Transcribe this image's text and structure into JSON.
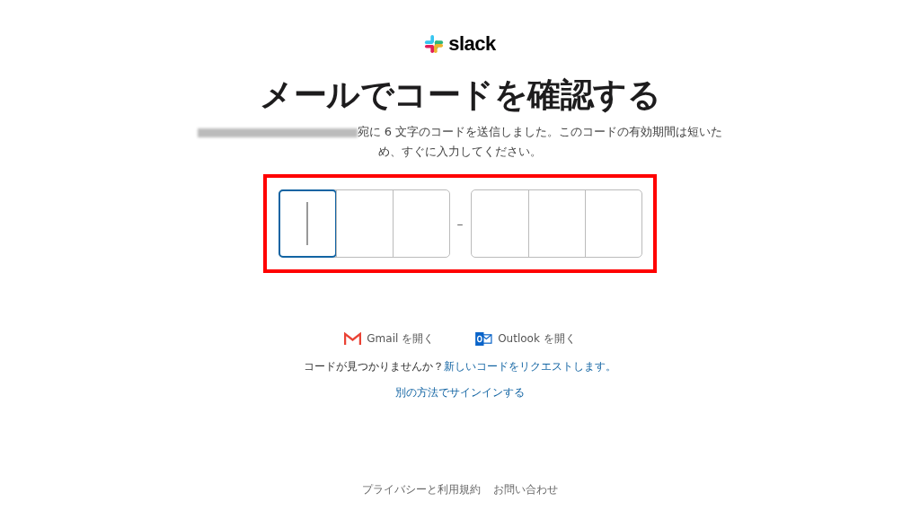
{
  "logo": {
    "wordmark": "slack"
  },
  "title": "メールでコードを確認する",
  "message": {
    "email_redacted": true,
    "text": "宛に 6 文字のコードを送信しました。このコードの有効期間は短いため、すぐに入力してください。"
  },
  "code_groups": [
    {
      "boxes": [
        {
          "selected": true
        },
        {
          "selected": false
        },
        {
          "selected": false
        }
      ]
    },
    {
      "boxes": [
        {
          "selected": false
        },
        {
          "selected": false
        },
        {
          "selected": false
        }
      ]
    }
  ],
  "separator": "–",
  "highlight": {
    "on": true
  },
  "mail_links": [
    {
      "kind": "gmail",
      "label": "Gmail を開く"
    },
    {
      "kind": "outlook",
      "label": "Outlook を開く"
    }
  ],
  "no_code": {
    "text": "コードが見つかりませんか？",
    "link": "新しいコードをリクエストします。"
  },
  "alternate_link": "別の方法でサインインする",
  "footer_links": [
    "プライバシーと利用規約",
    "お問い合わせ"
  ]
}
